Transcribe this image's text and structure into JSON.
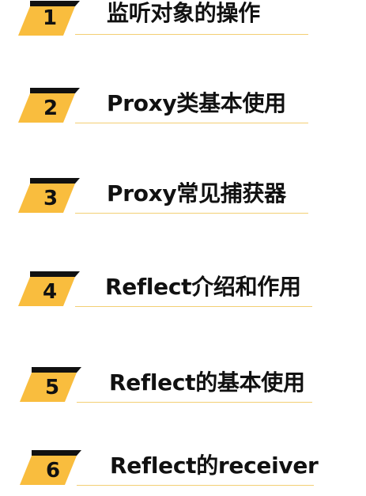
{
  "items": [
    {
      "number": "1",
      "title": "监听对象的操作"
    },
    {
      "number": "2",
      "title": "Proxy类基本使用"
    },
    {
      "number": "3",
      "title": "Proxy常见捕获器"
    },
    {
      "number": "4",
      "title": "Reflect介绍和作用"
    },
    {
      "number": "5",
      "title": "Reflect的基本使用"
    },
    {
      "number": "6",
      "title": "Reflect的receiver"
    }
  ],
  "colors": {
    "accent": "#f9bd3e",
    "line": "#f3cf74",
    "text": "#111111"
  }
}
